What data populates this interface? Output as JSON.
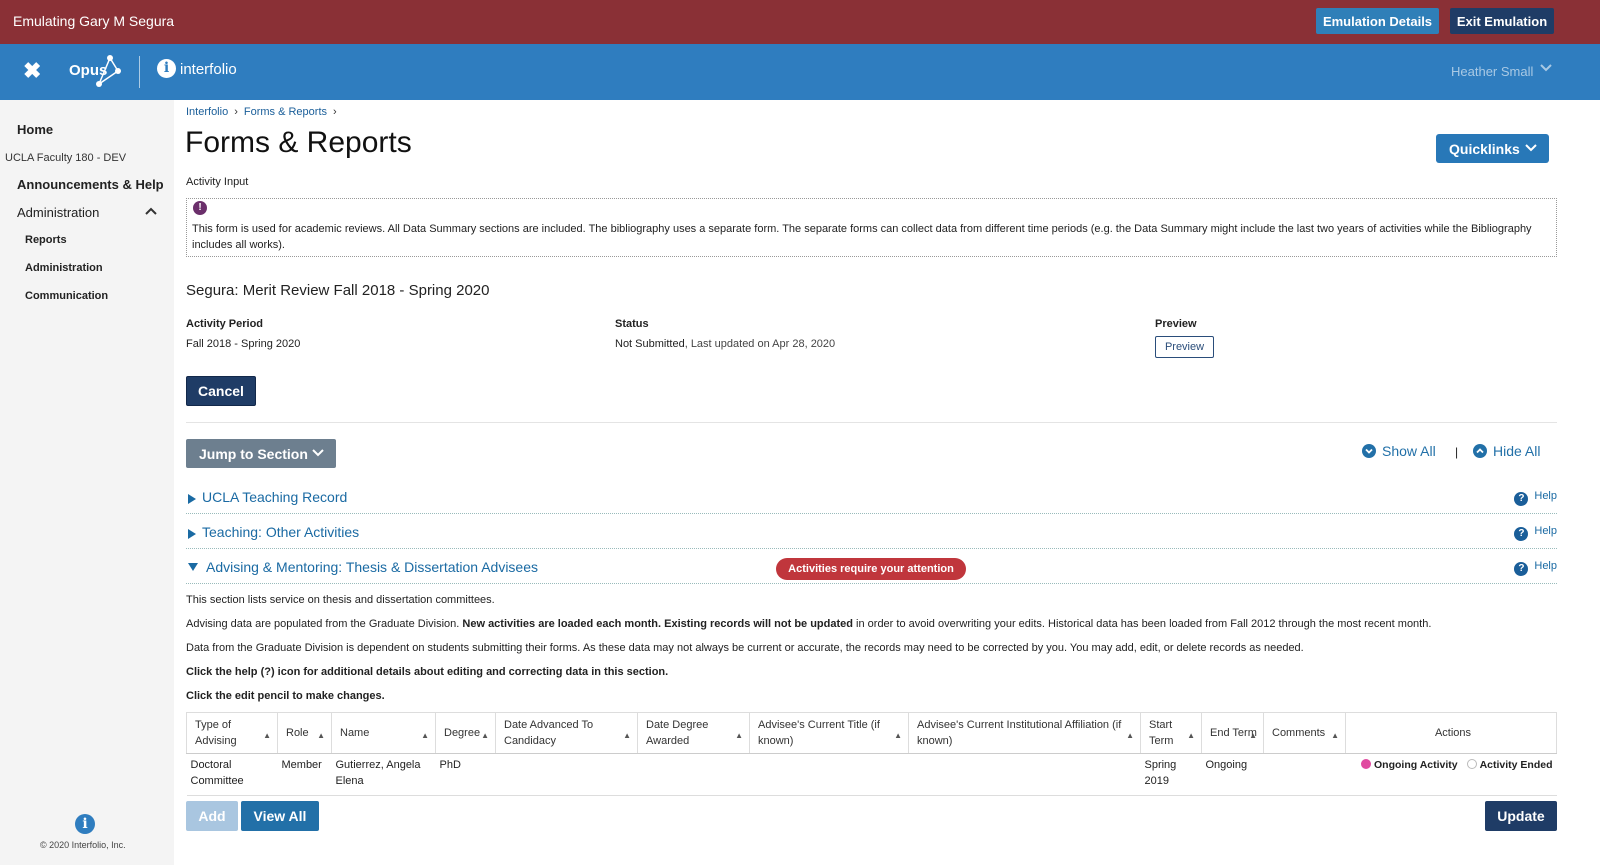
{
  "emulation": {
    "title": "Emulating Gary M Segura",
    "details_label": "Emulation Details",
    "exit_label": "Exit Emulation",
    "color": "#8a3036"
  },
  "nav": {
    "close_glyph": "✖",
    "opus_label": "Opus",
    "interfolio_icon": "i",
    "interfolio_label": "interfolio",
    "user": "Heather Small",
    "color": "#2f7dbf"
  },
  "sidebar": {
    "home": "Home",
    "org": "UCLA Faculty 180 - DEV",
    "announcements": "Announcements & Help",
    "administration": "Administration",
    "subitems": [
      "Reports",
      "Administration",
      "Communication"
    ],
    "info_icon": "i",
    "copyright": "© 2020 Interfolio, Inc."
  },
  "breadcrumb": [
    "Interfolio",
    "Forms & Reports"
  ],
  "page": {
    "title": "Forms & Reports",
    "quicklinks_label": "Quicklinks",
    "activity_input": "Activity Input",
    "info_icon": "!",
    "info_text": "This form is used for academic reviews. All Data Summary sections are included. The bibliography uses a separate form. The separate forms can collect data from different time periods  (e.g. the Data Summary might include the last two years of activities while the Bibliography includes all works).",
    "review_title": "Segura: Merit Review Fall 2018 - Spring 2020",
    "activity_period_label": "Activity Period",
    "activity_period_value": "Fall 2018 - Spring 2020",
    "status_label": "Status",
    "status_value": "Not Submitted",
    "status_updated": ", Last updated on Apr 28, 2020",
    "preview_label": "Preview",
    "preview_button": "Preview",
    "cancel_label": "Cancel"
  },
  "controls": {
    "jump_label": "Jump to Section",
    "show_all": "Show All",
    "pipe": "|",
    "hide_all": "Hide All"
  },
  "sections": [
    {
      "title": "UCLA Teaching Record",
      "help": "Help",
      "expanded": false
    },
    {
      "title": "Teaching: Other Activities",
      "help": "Help",
      "expanded": false
    },
    {
      "title": "Advising & Mentoring: Thesis & Dissertation Advisees",
      "help": "Help",
      "expanded": true,
      "badge": "Activities require your attention"
    }
  ],
  "section_body": {
    "line1": "This section lists service on thesis and dissertation committees.",
    "line2_a": "Advising data are populated from the Graduate Division. ",
    "line2_b": "New activities are loaded each month. Existing records will not be updated",
    "line2_c": " in order to avoid overwriting your edits. Historical data has been loaded from Fall 2012 through the most recent month.",
    "line3": "Data from the Graduate Division is dependent on students submitting their forms. As these data may not always be current or accurate, the records may need to be corrected by you. You may add, edit, or delete records as needed.",
    "line4": "Click the help (?) icon for additional details about editing and correcting data in this section.",
    "line5": "Click the edit pencil to make changes."
  },
  "table": {
    "headers": [
      "Type of Advising",
      "Role",
      "Name",
      "Degree",
      "Date Advanced To Candidacy",
      "Date Degree Awarded",
      "Advisee's Current Title (if known)",
      "Advisee's Current Institutional Affiliation (if known)",
      "Start Term",
      "End Term",
      "Comments",
      "Actions"
    ],
    "rows": [
      {
        "type": "Doctoral Committee",
        "role": "Member",
        "name": "Gutierrez, Angela Elena",
        "degree": "PhD",
        "candidacy": "",
        "awarded": "",
        "title": "",
        "affiliation": "",
        "start": "Spring 2019",
        "end": "Ongoing",
        "comments": "",
        "action_ongoing": "Ongoing Activity",
        "action_ended": "Activity Ended",
        "selected": "Ongoing Activity"
      }
    ]
  },
  "footer_buttons": {
    "add": "Add",
    "view_all": "View All",
    "update": "Update"
  }
}
